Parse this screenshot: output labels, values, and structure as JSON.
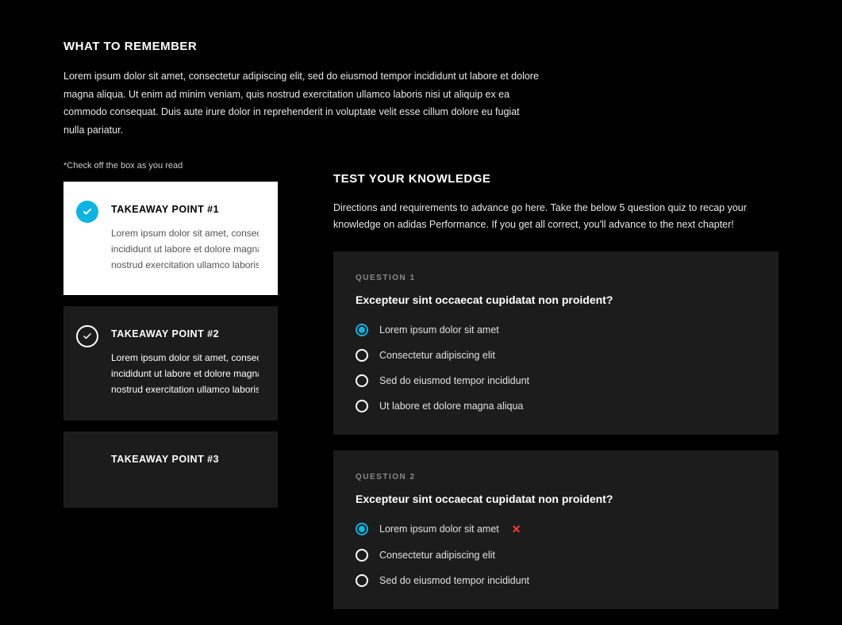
{
  "header": {
    "title": "WHAT TO REMEMBER",
    "intro": "Lorem ipsum dolor sit amet, consectetur adipiscing elit, sed do eiusmod tempor incididunt ut labore et dolore magna aliqua. Ut enim ad minim veniam, quis nostrud exercitation ullamco laboris nisi ut aliquip ex ea commodo consequat. Duis aute irure dolor in reprehenderit in voluptate velit esse cillum dolore eu fugiat nulla pariatur."
  },
  "left": {
    "hint": "*Check off the box as you read",
    "takeaways": [
      {
        "title": "TAKEAWAY POINT #1",
        "body_line1": "Lorem ipsum dolor sit amet, consectetur",
        "body_line2": "incididunt ut labore et dolore magna aliqua",
        "body_line3": "nostrud exercitation ullamco laboris nisi",
        "checked": true
      },
      {
        "title": "TAKEAWAY POINT #2",
        "body_line1": "Lorem ipsum dolor sit amet, consectetur",
        "body_line2": "incididunt ut labore et dolore magna aliqua",
        "body_line3": "nostrud exercitation ullamco laboris nisi",
        "checked": false
      },
      {
        "title": "TAKEAWAY POINT #3",
        "body_line1": "",
        "body_line2": "",
        "body_line3": "",
        "checked": false
      }
    ]
  },
  "right": {
    "title": "TEST YOUR KNOWLEDGE",
    "intro": "Directions and requirements to advance go here. Take the below 5 question quiz to recap your knowledge on adidas Performance. If you get all correct, you'll advance to the next chapter!",
    "questions": [
      {
        "label": "QUESTION 1",
        "text": "Excepteur sint occaecat cupidatat non proident?",
        "answers": [
          {
            "text": "Lorem ipsum dolor sit amet",
            "selected": true,
            "wrong": false
          },
          {
            "text": "Consectetur adipiscing elit",
            "selected": false,
            "wrong": false
          },
          {
            "text": "Sed do eiusmod tempor incididunt",
            "selected": false,
            "wrong": false
          },
          {
            "text": "Ut labore et dolore magna aliqua",
            "selected": false,
            "wrong": false
          }
        ]
      },
      {
        "label": "QUESTION 2",
        "text": "Excepteur sint occaecat cupidatat non proident?",
        "answers": [
          {
            "text": "Lorem ipsum dolor sit amet",
            "selected": true,
            "wrong": true
          },
          {
            "text": "Consectetur adipiscing elit",
            "selected": false,
            "wrong": false
          },
          {
            "text": "Sed do eiusmod tempor incididunt",
            "selected": false,
            "wrong": false
          }
        ]
      }
    ]
  },
  "colors": {
    "accent": "#0db4e0",
    "error": "#ff3b3b",
    "card_dark": "#1c1c1c"
  }
}
